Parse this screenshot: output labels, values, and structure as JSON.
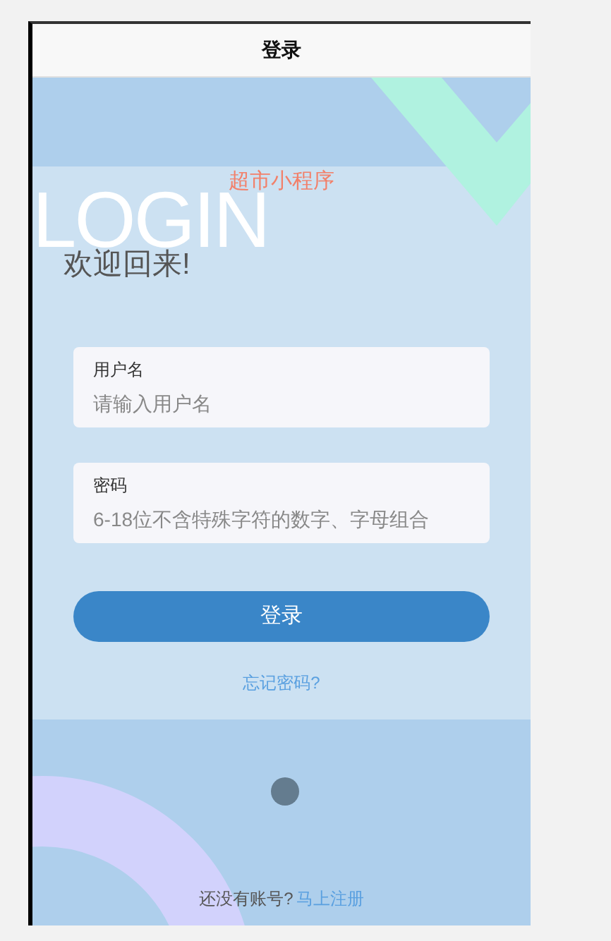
{
  "nav_bar": {
    "title": "登录"
  },
  "app_name": "超市小程序",
  "background_word": "LOGIN",
  "welcome": "欢迎回来!",
  "fields": [
    {
      "label": "用户名",
      "placeholder": "请输入用户名"
    },
    {
      "label": "密码",
      "placeholder": "6-18位不含特殊字符的数字、字母组合"
    }
  ],
  "login_button": "登录",
  "forgot_link": "忘记密码?",
  "footer": {
    "prompt": "还没有账号?",
    "register_link": "马上注册"
  }
}
